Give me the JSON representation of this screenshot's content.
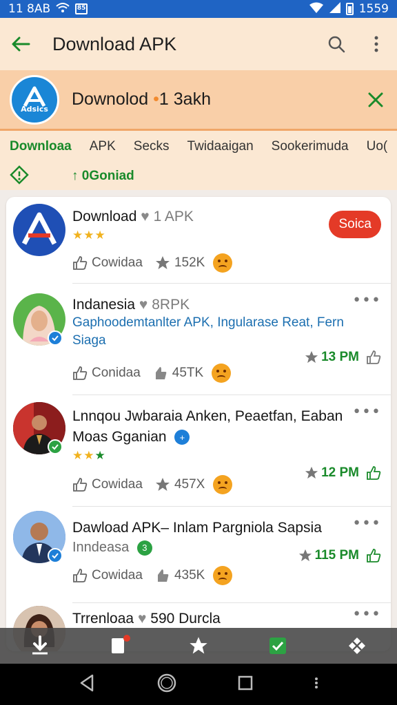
{
  "status_bar": {
    "left_text": "11 8AB",
    "box_label": "85",
    "time": "1559"
  },
  "app_bar": {
    "title": "Download APK"
  },
  "banner": {
    "logo_text": "Adsics",
    "text_main": "Downolod",
    "text_dot": "•",
    "text_num": "1 3akh"
  },
  "tabs": {
    "items": [
      "Downloaa",
      "APK",
      "Secks",
      "Twidaaigan",
      "Sookerimuda",
      "Uo("
    ],
    "download_count": "0Goniad",
    "download_arrow": "↑"
  },
  "items": [
    {
      "title": "Download",
      "title_extra": "1 APK",
      "stars": "★★★",
      "action_label": "Soica",
      "stat1_label": "Cowidaa",
      "stat2_value": "152K"
    },
    {
      "title": "Indanesia",
      "title_extra": "8RPK",
      "desc": "Gaphoodemtanlter APK, Ingularase Reat, Fern Siaga",
      "stat1_label": "Conidaa",
      "stat2_value": "45TK",
      "time": "13 PM"
    },
    {
      "title_line1": "Lnnqou Jwbaraia Anken, Peaetfan, Eaban",
      "title_line2": "Moas Gganian",
      "stars": "★★★",
      "stat1_label": "Cowidaa",
      "stat2_value": "457X",
      "time": "12 PM"
    },
    {
      "title": "Dawload APK– Inlam Pargniola Sapsia",
      "sub": "Inndeasa",
      "badge": "3",
      "stat1_label": "Cowidaa",
      "stat2_value": "435K",
      "time": "115 PM"
    },
    {
      "title": "Trrenloaa",
      "title_extra": "590 Durcla"
    }
  ],
  "colors": {
    "accent_green": "#198a2a",
    "accent_blue": "#1e7fd8",
    "red": "#e43a27",
    "orange": "#f28a2e"
  },
  "icons": [
    "back-arrow-icon",
    "search-icon",
    "more-vert-icon",
    "close-icon",
    "star-icon",
    "like-icon",
    "heart-icon"
  ]
}
